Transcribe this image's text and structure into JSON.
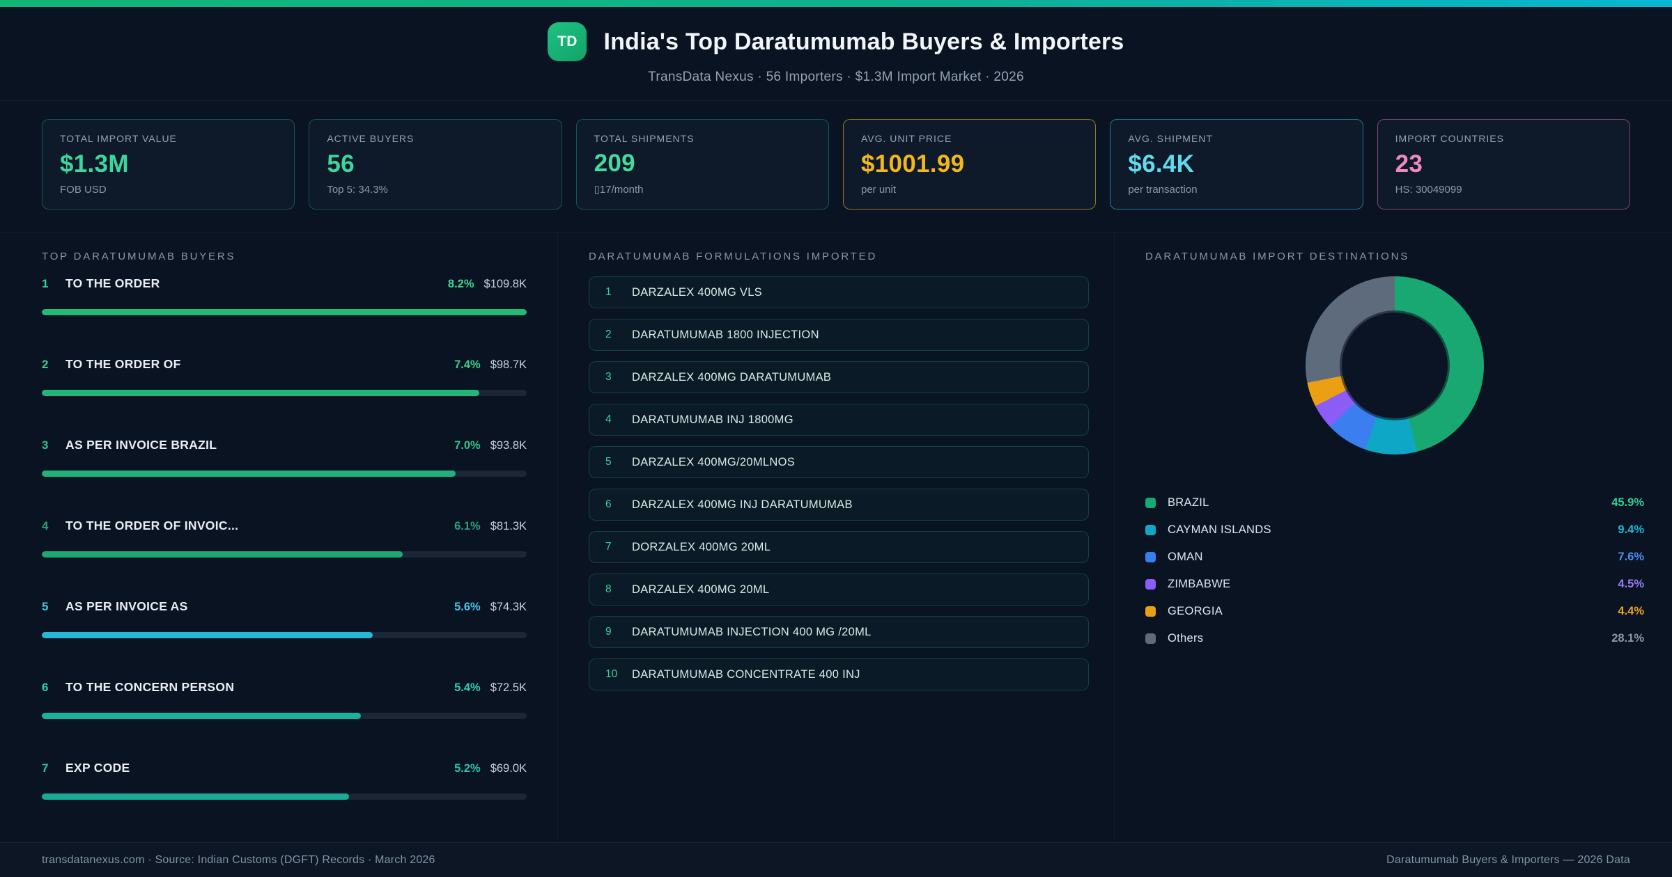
{
  "header": {
    "badge": "TD",
    "title": "India's Top Daratumumab Buyers & Importers",
    "subtitle": "TransData Nexus · 56 Importers · $1.3M Import Market · 2026"
  },
  "stats": [
    {
      "label": "TOTAL IMPORT VALUE",
      "value": "$1.3M",
      "sub": "FOB USD",
      "accent": "#3ed69b",
      "border": "rgba(45,212,191,0.32)"
    },
    {
      "label": "ACTIVE BUYERS",
      "value": "56",
      "sub": "Top 5: 34.3%",
      "accent": "#3ed69b",
      "border": "rgba(45,212,191,0.32)"
    },
    {
      "label": "TOTAL SHIPMENTS",
      "value": "209",
      "sub": "▯17/month",
      "accent": "#49db9e",
      "border": "rgba(45,212,191,0.32)"
    },
    {
      "label": "AVG. UNIT PRICE",
      "value": "$1001.99",
      "sub": "per unit",
      "accent": "#f3b71d",
      "border": "rgba(250,204,21,0.55)"
    },
    {
      "label": "AVG. SHIPMENT",
      "value": "$6.4K",
      "sub": "per transaction",
      "accent": "#62d9ec",
      "border": "rgba(34,211,238,0.55)"
    },
    {
      "label": "IMPORT COUNTRIES",
      "value": "23",
      "sub": "HS: 30049099",
      "accent": "#ee8abd",
      "border": "rgba(244,114,182,0.5)"
    }
  ],
  "panels": {
    "buyers_title": "TOP DARATUMUMAB BUYERS",
    "formulations_title": "DARATUMUMAB FORMULATIONS IMPORTED",
    "destinations_title": "DARATUMUMAB IMPORT DESTINATIONS"
  },
  "chart_data": [
    {
      "type": "bar",
      "title": "TOP DARATUMUMAB BUYERS",
      "orientation": "horizontal",
      "xlim": [
        0,
        8.2
      ],
      "rows": [
        {
          "rank": "1",
          "name": "TO THE ORDER",
          "pct": 8.2,
          "pct_label": "8.2%",
          "value_label": "$109.8K",
          "color": "#23b977",
          "pct_color": "#38d793"
        },
        {
          "rank": "2",
          "name": "TO THE ORDER OF",
          "pct": 7.4,
          "pct_label": "7.4%",
          "value_label": "$98.7K",
          "color": "#22b677",
          "pct_color": "#35d18e"
        },
        {
          "rank": "3",
          "name": "AS PER INVOICE BRAZIL",
          "pct": 7.0,
          "pct_label": "7.0%",
          "value_label": "$93.8K",
          "color": "#20b278",
          "pct_color": "#2cc489"
        },
        {
          "rank": "4",
          "name": "TO THE ORDER OF INVOIC...",
          "pct": 6.1,
          "pct_label": "6.1%",
          "value_label": "$81.3K",
          "color": "#1da973",
          "pct_color": "#2f9f7e"
        },
        {
          "rank": "5",
          "name": "AS PER INVOICE AS",
          "pct": 5.6,
          "pct_label": "5.6%",
          "value_label": "$74.3K",
          "color": "#28b7d9",
          "pct_color": "#41c6ea"
        },
        {
          "rank": "6",
          "name": "TO THE CONCERN PERSON",
          "pct": 5.4,
          "pct_label": "5.4%",
          "value_label": "$72.5K",
          "color": "#1bb29d",
          "pct_color": "#2fcbb2"
        },
        {
          "rank": "7",
          "name": "EXP CODE",
          "pct": 5.2,
          "pct_label": "5.2%",
          "value_label": "$69.0K",
          "color": "#19ab97",
          "pct_color": "#2cc4ad"
        }
      ]
    },
    {
      "type": "pie",
      "donut": true,
      "title": "DARATUMUMAB IMPORT DESTINATIONS",
      "legend_position": "bottom",
      "slices": [
        {
          "label": "BRAZIL",
          "value": 45.9,
          "pct_label": "45.9%",
          "color": "#19a871",
          "pct_color": "#2fd08e"
        },
        {
          "label": "CAYMAN ISLANDS",
          "value": 9.4,
          "pct_label": "9.4%",
          "color": "#0ea7c6",
          "pct_color": "#19b8d4"
        },
        {
          "label": "OMAN",
          "value": 7.6,
          "pct_label": "7.6%",
          "color": "#3b7ef0",
          "pct_color": "#4c8df6"
        },
        {
          "label": "ZIMBABWE",
          "value": 4.5,
          "pct_label": "4.5%",
          "color": "#8b5cf6",
          "pct_color": "#9d7bf7"
        },
        {
          "label": "GEORGIA",
          "value": 4.4,
          "pct_label": "4.4%",
          "color": "#eb9f15",
          "pct_color": "#f0a51c"
        },
        {
          "label": "Others",
          "value": 28.1,
          "pct_label": "28.1%",
          "color": "#5d6b7d",
          "pct_color": "#8b98a9"
        }
      ]
    }
  ],
  "formulations": [
    {
      "rank": "1",
      "name": "DARZALEX 400MG VLS"
    },
    {
      "rank": "2",
      "name": "DARATUMUMAB 1800 INJECTION"
    },
    {
      "rank": "3",
      "name": "DARZALEX 400MG DARATUMUMAB"
    },
    {
      "rank": "4",
      "name": "DARATUMUMAB INJ 1800MG"
    },
    {
      "rank": "5",
      "name": "DARZALEX 400MG/20MLNOS"
    },
    {
      "rank": "6",
      "name": "DARZALEX 400MG INJ DARATUMUMAB"
    },
    {
      "rank": "7",
      "name": "DORZALEX 400MG 20ML"
    },
    {
      "rank": "8",
      "name": "DARZALEX 400MG 20ML"
    },
    {
      "rank": "9",
      "name": "DARATUMUMAB INJECTION 400 MG /20ML"
    },
    {
      "rank": "10",
      "name": "DARATUMUMAB CONCENTRATE 400 INJ"
    }
  ],
  "footer": {
    "left": "transdatanexus.com · Source: Indian Customs (DGFT) Records · March 2026",
    "right": "Daratumumab Buyers & Importers — 2026 Data"
  }
}
